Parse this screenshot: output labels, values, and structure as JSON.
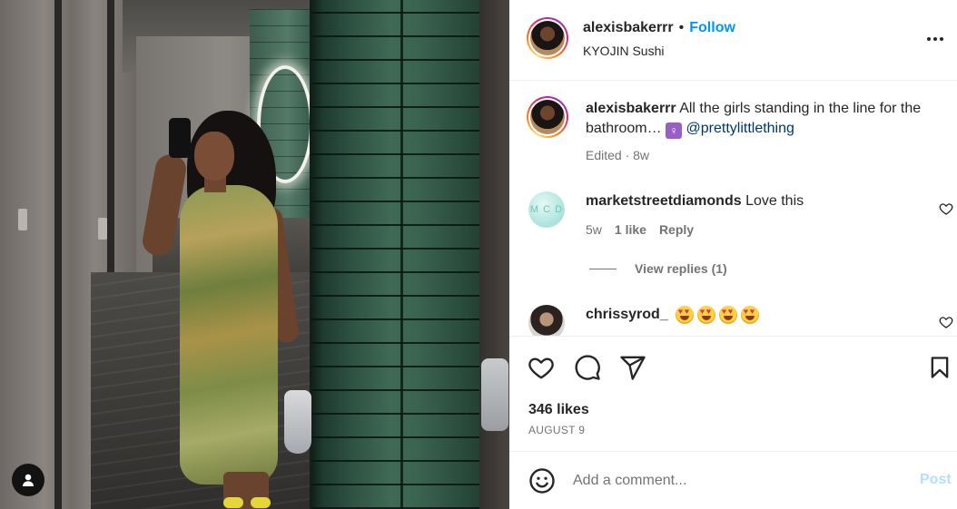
{
  "post": {
    "author": "alexisbakerrr",
    "follow_label": "Follow",
    "separator": "•",
    "location": "KYOJIN Sushi"
  },
  "caption": {
    "username": "alexisbakerrr",
    "text": "All the girls standing in the line for the bathroom…",
    "emoji": "restroom",
    "mention": "@prettylittlething",
    "meta": "Edited · 8w"
  },
  "comments": [
    {
      "username": "marketstreetdiamonds",
      "text": "Love this",
      "avatar_text": "M C D",
      "time": "5w",
      "likes": "1 like",
      "reply_label": "Reply",
      "view_replies": "View replies (1)"
    },
    {
      "username": "chrissyrod_",
      "emoji": "smiling-face-with-heart-eyes",
      "emoji_count": 4
    }
  ],
  "stats": {
    "likes": "346 likes",
    "date": "AUGUST 9"
  },
  "add_comment": {
    "placeholder": "Add a comment...",
    "post_label": "Post"
  },
  "colors": {
    "accent": "#0095f6",
    "post_disabled": "#b2dffc",
    "mention": "#00376b",
    "meta": "#737373"
  },
  "icons": [
    "user-tag-icon",
    "more-options-icon",
    "heart-icon",
    "comment-icon",
    "share-icon",
    "bookmark-icon",
    "emoji-icon"
  ]
}
